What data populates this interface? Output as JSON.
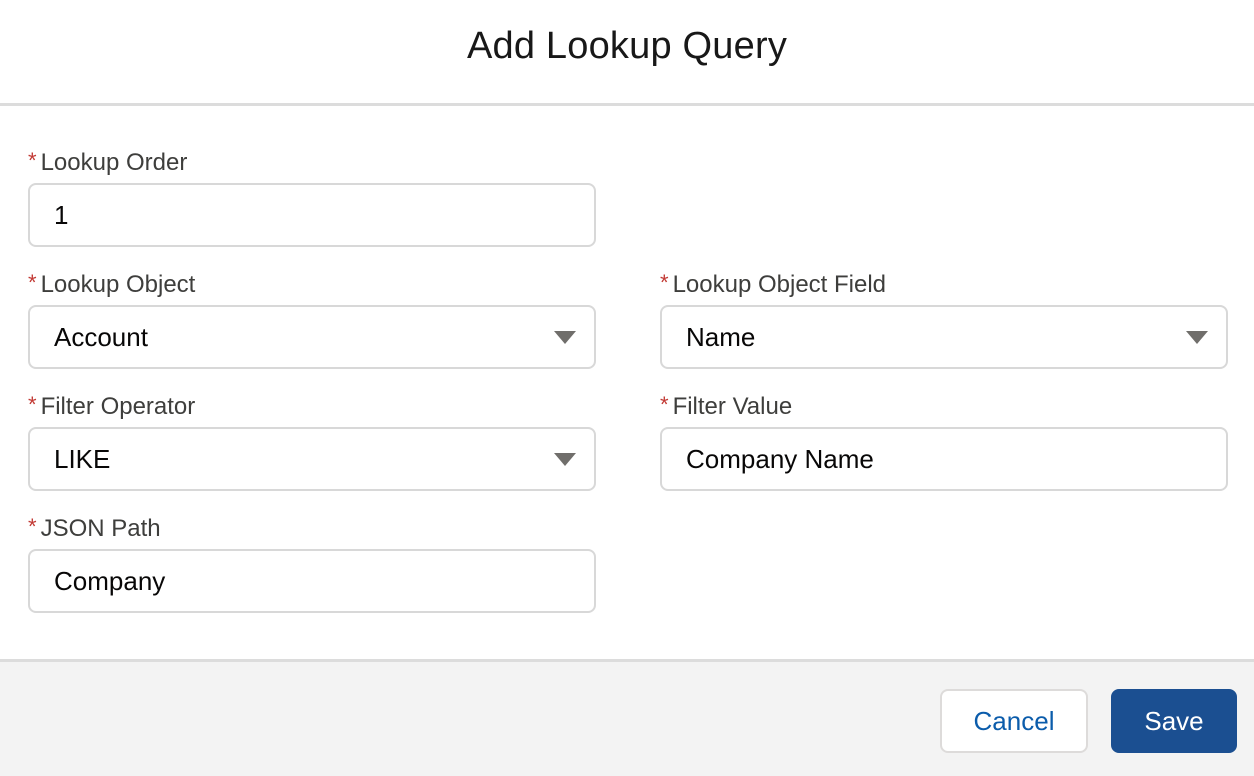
{
  "modal": {
    "title": "Add Lookup Query"
  },
  "form": {
    "required_marker": "*",
    "lookup_order": {
      "label": "Lookup Order",
      "value": "1"
    },
    "lookup_object": {
      "label": "Lookup Object",
      "value": "Account"
    },
    "lookup_object_field": {
      "label": "Lookup Object Field",
      "value": "Name"
    },
    "filter_operator": {
      "label": "Filter Operator",
      "value": "LIKE"
    },
    "filter_value": {
      "label": "Filter Value",
      "value": "Company Name"
    },
    "json_path": {
      "label": "JSON Path",
      "value": "Company"
    }
  },
  "footer": {
    "cancel_label": "Cancel",
    "save_label": "Save"
  },
  "icons": {
    "select_arrow": "chevron-down-icon"
  },
  "colors": {
    "required": "#c23934",
    "primary_button": "#1b4f91",
    "link_text": "#0b5cab",
    "footer_background": "#f3f3f3"
  }
}
